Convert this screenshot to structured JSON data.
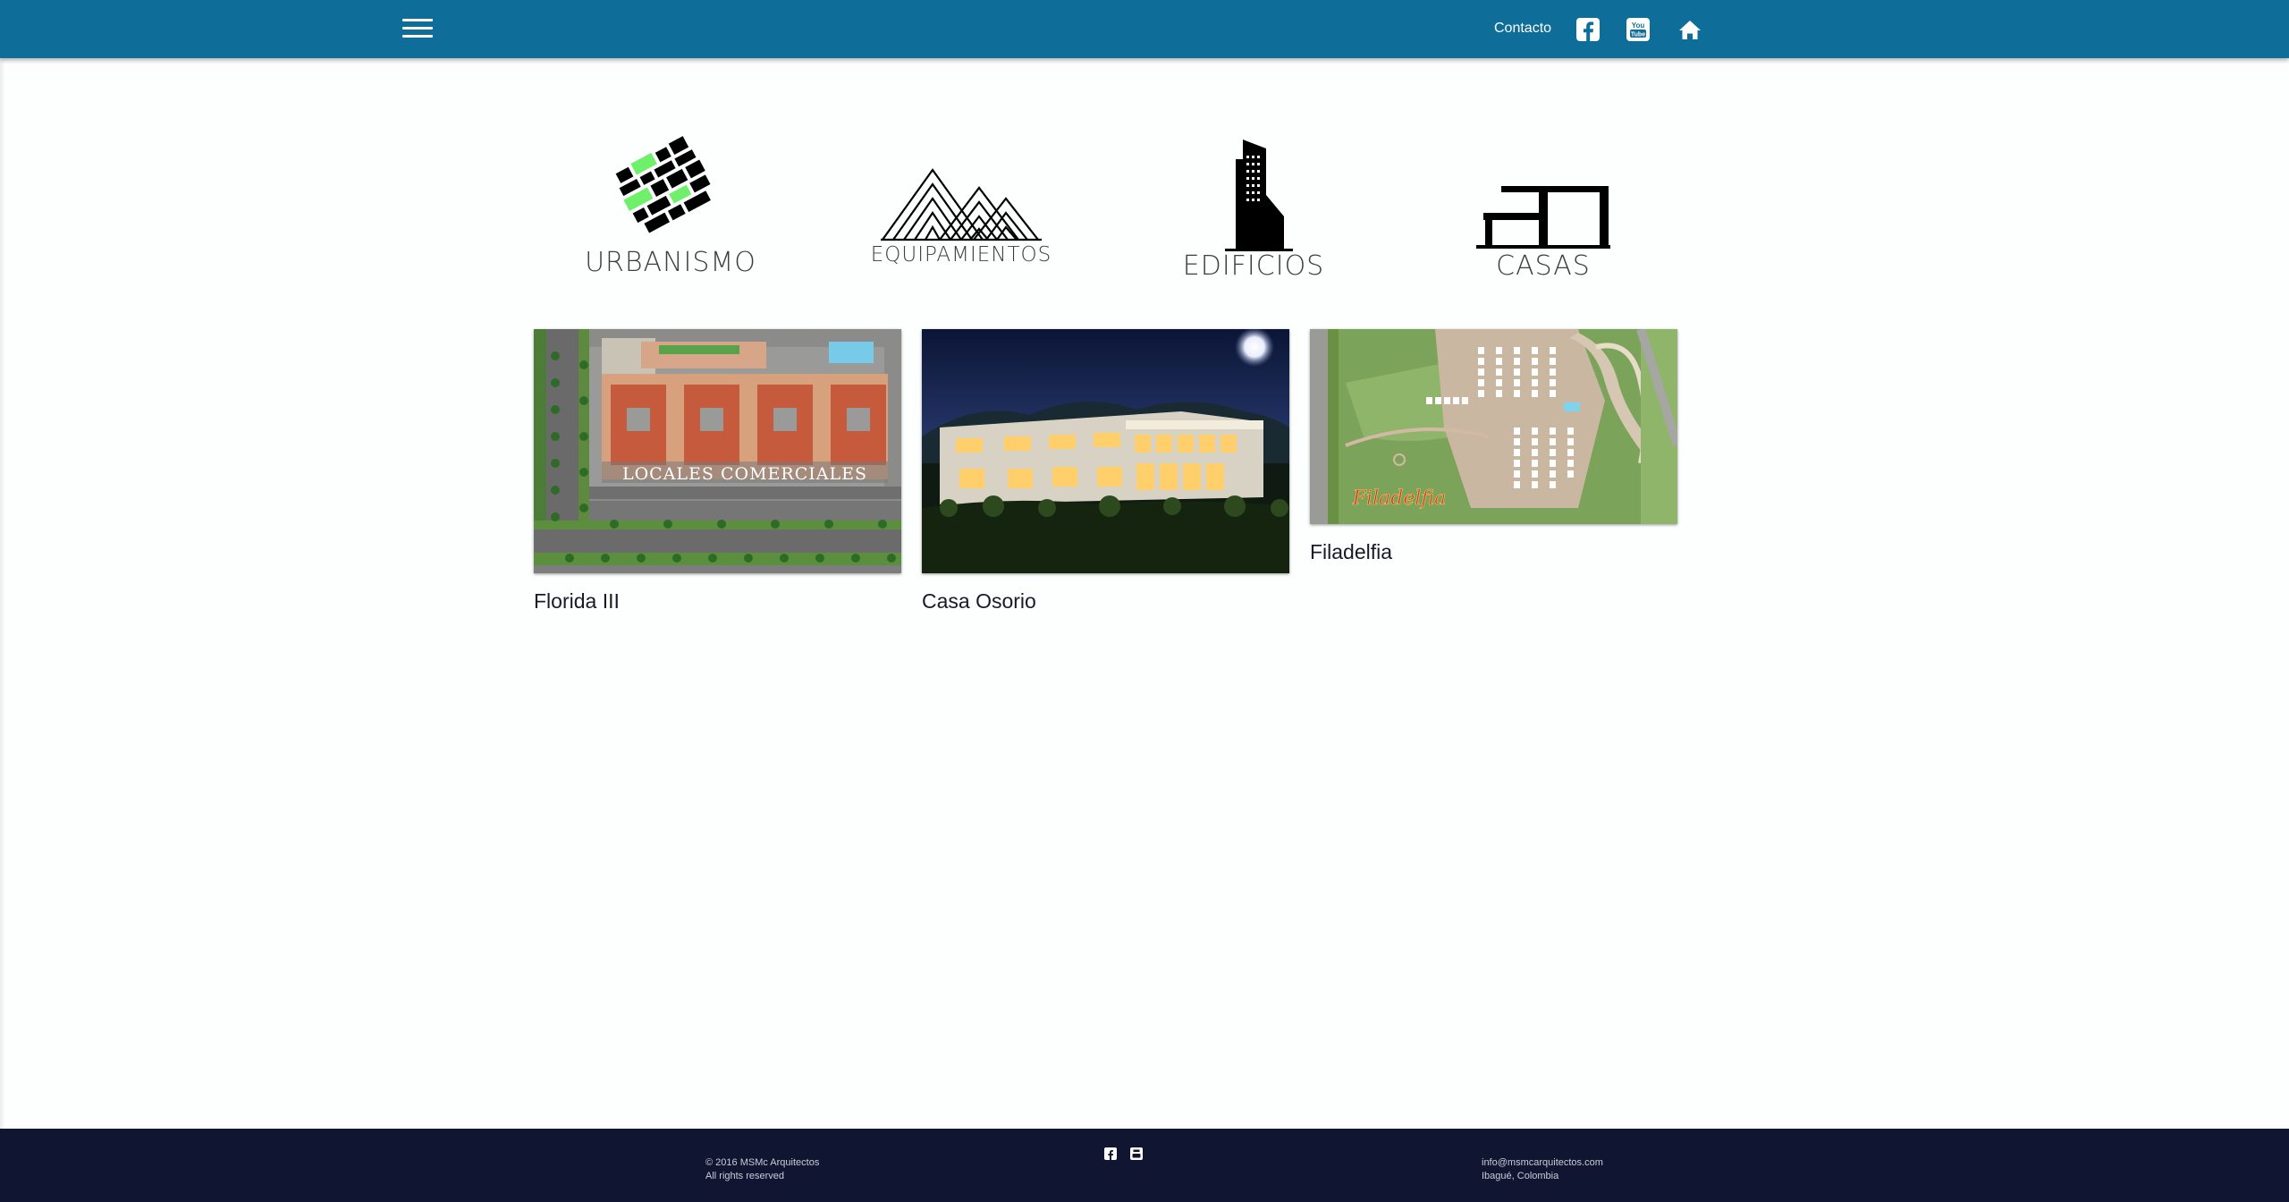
{
  "header": {
    "menu_icon": "hamburger-menu-icon",
    "contact_label": "Contacto",
    "icons": [
      "facebook-icon",
      "youtube-icon",
      "home-icon"
    ]
  },
  "categories": [
    {
      "label": "URBANISMO",
      "icon": "urban-plan-icon"
    },
    {
      "label": "EQUIPAMIENTOS",
      "icon": "mountain-lines-icon"
    },
    {
      "label": "EDIFICIOS",
      "icon": "tower-building-icon"
    },
    {
      "label": "CASAS",
      "icon": "modern-house-icon"
    }
  ],
  "projects": [
    {
      "title": "Florida III",
      "image_caption": "LOCALES COMERCIALES"
    },
    {
      "title": "Casa Osorio"
    },
    {
      "title": "Filadelfia",
      "image_caption": "Filadelfia"
    }
  ],
  "footer": {
    "copyright": "© 2016 MSMc Arquitectos",
    "rights": "All rights reserved",
    "email": "info@msmcarquitectos.com",
    "location": "Ibagué, Colombia",
    "icons": [
      "facebook-icon",
      "youtube-icon"
    ]
  },
  "colors": {
    "header_bg": "#0f6e99",
    "footer_bg": "#101631",
    "page_bg": "#fdfefe",
    "urban_accent": "#6ef06a"
  }
}
